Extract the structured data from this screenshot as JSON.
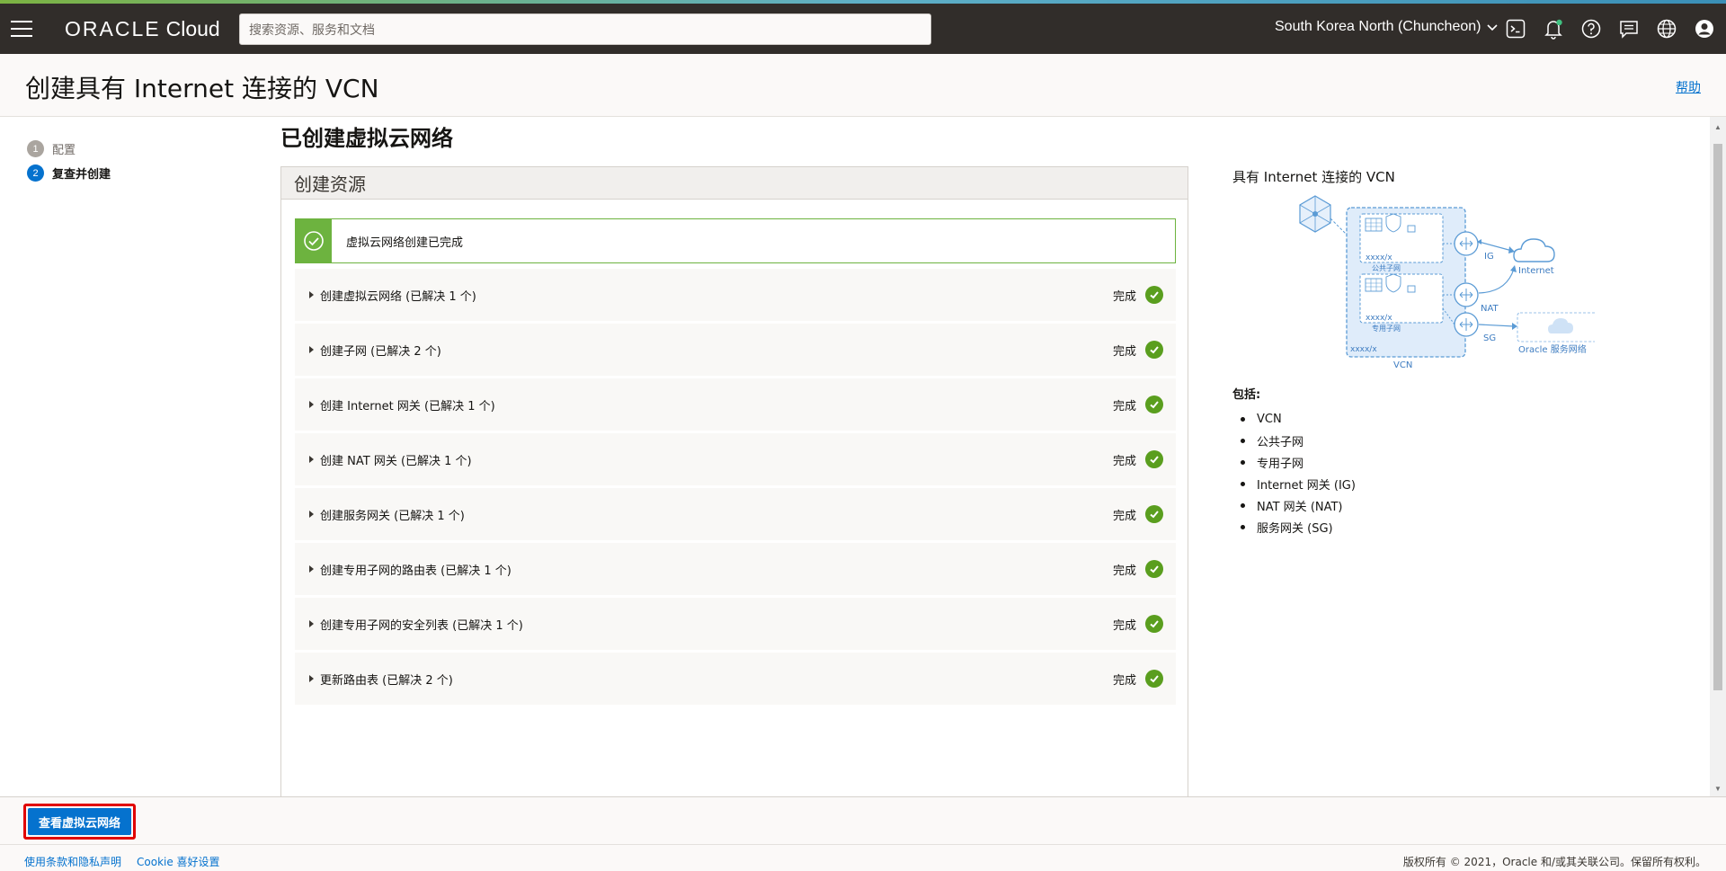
{
  "topbar": {
    "logo_brand": "ORACLE",
    "logo_product": "Cloud",
    "search_placeholder": "搜索资源、服务和文档",
    "region": "South Korea North (Chuncheon)"
  },
  "header": {
    "title": "创建具有 Internet 连接的 VCN",
    "help": "帮助"
  },
  "steps": [
    {
      "number": "1",
      "label": "配置"
    },
    {
      "number": "2",
      "label": "复查并创建"
    }
  ],
  "main": {
    "heading": "已创建虚拟云网络",
    "panel_title": "创建资源",
    "success_message": "虚拟云网络创建已完成",
    "tasks": [
      {
        "label": "创建虚拟云网络 (已解决 1 个)",
        "status": "完成"
      },
      {
        "label": "创建子网 (已解决 2 个)",
        "status": "完成"
      },
      {
        "label": "创建 Internet 网关 (已解决 1 个)",
        "status": "完成"
      },
      {
        "label": "创建 NAT 网关 (已解决 1 个)",
        "status": "完成"
      },
      {
        "label": "创建服务网关 (已解决 1 个)",
        "status": "完成"
      },
      {
        "label": "创建专用子网的路由表 (已解决 1 个)",
        "status": "完成"
      },
      {
        "label": "创建专用子网的安全列表 (已解决 1 个)",
        "status": "完成"
      },
      {
        "label": "更新路由表 (已解决 2 个)",
        "status": "完成"
      }
    ]
  },
  "side": {
    "title": "具有 Internet 连接的 VCN",
    "diagram": {
      "public_subnet": "公共子网",
      "private_subnet": "专用子网",
      "cidr": "xxxx/x",
      "ig": "IG",
      "nat": "NAT",
      "sg": "SG",
      "internet": "Internet",
      "vcn": "VCN",
      "oracle_network": "Oracle 服务网络"
    },
    "includes_title": "包括:",
    "includes": [
      "VCN",
      "公共子网",
      "专用子网",
      "Internet 网关 (IG)",
      "NAT 网关 (NAT)",
      "服务网关 (SG)"
    ]
  },
  "actions": {
    "view_vcn": "查看虚拟云网络"
  },
  "footer": {
    "terms": "使用条款和隐私声明",
    "cookie": "Cookie 喜好设置",
    "copyright": "版权所有 © 2021，Oracle 和/或其关联公司。保留所有权利。"
  },
  "colors": {
    "topbar": "#312d2a",
    "primary": "#0572ce",
    "success": "#6db33f",
    "highlight": "#e10000"
  }
}
